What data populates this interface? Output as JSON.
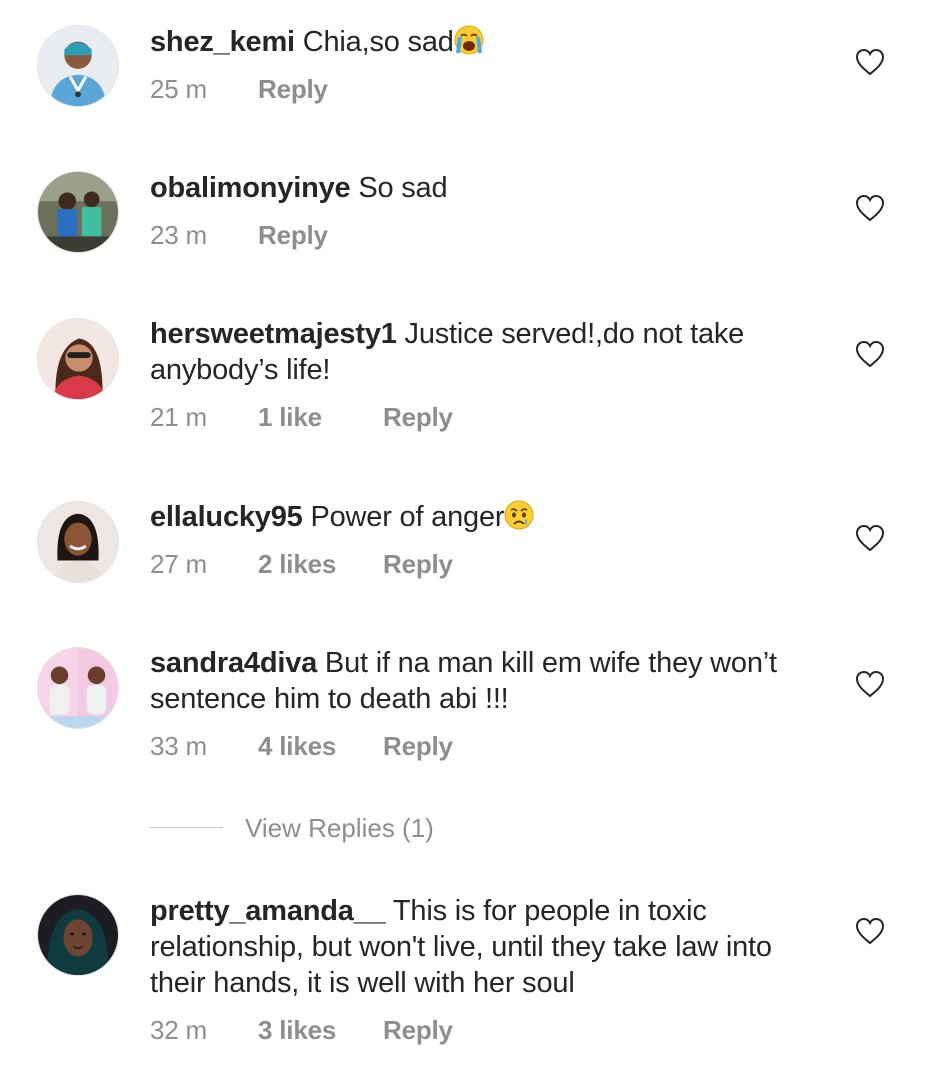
{
  "comments": [
    {
      "username": "shez_kemi",
      "text": "Chia,so sad",
      "emoji": "loudly-crying-face-emoji",
      "time": "25 m",
      "likes": "",
      "reply": "Reply"
    },
    {
      "username": "obalimonyinye",
      "text": "So sad",
      "emoji": "",
      "time": "23 m",
      "likes": "",
      "reply": "Reply"
    },
    {
      "username": "hersweetmajesty1",
      "text": "Justice served!,do not take anybody’s life!",
      "emoji": "",
      "time": "21 m",
      "likes": "1 like",
      "reply": "Reply"
    },
    {
      "username": "ellalucky95",
      "text": "Power of anger",
      "emoji": "crying-face-emoji",
      "time": "27 m",
      "likes": "2 likes",
      "reply": "Reply"
    },
    {
      "username": "sandra4diva",
      "text": "But if na man kill em wife they won’t sentence him to death abi !!!",
      "emoji": "",
      "time": "33 m",
      "likes": "4 likes",
      "reply": "Reply"
    },
    {
      "username": "pretty_amanda__",
      "text": "This is for people in toxic relationship, but won't live, until they take law into their hands, it is well with her soul",
      "emoji": "",
      "time": "32 m",
      "likes": "3 likes",
      "reply": "Reply"
    }
  ],
  "view_replies": "View Replies (1)",
  "icons": {
    "like": "heart-outline-icon"
  },
  "colors": {
    "text": "#262626",
    "secondary": "#8e8e8e",
    "divider": "#c7c7c7"
  }
}
